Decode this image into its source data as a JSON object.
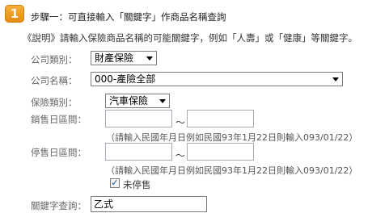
{
  "step": {
    "number": "1",
    "title": "步驟一：可直接輸入「關鍵字」作商品名稱查詢"
  },
  "description": "《說明》請輸入保險商品名稱的可能關鍵字，例如「人壽」或「健康」等關鍵字。",
  "company_type": {
    "label": "公司類別：",
    "value": "財產保險"
  },
  "company_name": {
    "label": "公司名稱：",
    "value": "000-產險全部"
  },
  "insurance_type": {
    "label": "保險類別：",
    "value": "汽車保險"
  },
  "sale_date": {
    "label": "銷售日區間：",
    "from": "",
    "to": "",
    "separator": "～",
    "hint": "（請輸入民國年月日例如民國93年1月22日則輸入093/01/22）"
  },
  "stop_date": {
    "label": "停售日區間：",
    "from": "",
    "to": "",
    "separator": "～",
    "hint": "（請輸入民國年月日例如民國93年1月22日則輸入093/01/22）"
  },
  "not_discontinued": {
    "label": "未停售",
    "checked": true
  },
  "keyword": {
    "label": "關鍵字查詢：",
    "value": "乙式"
  }
}
